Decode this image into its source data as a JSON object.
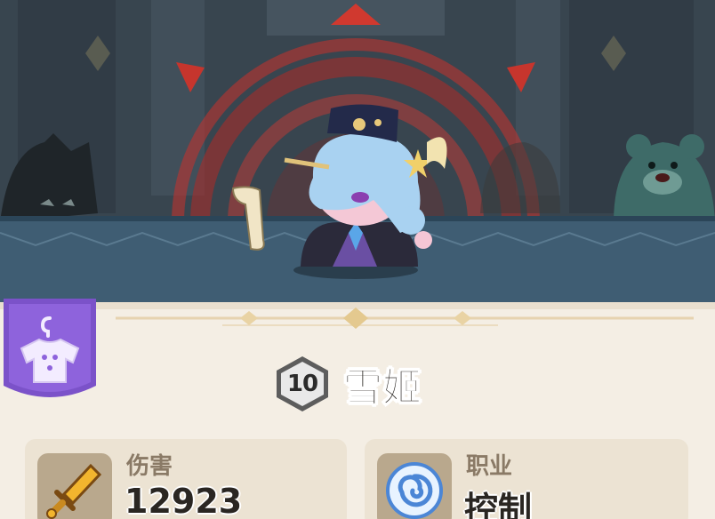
{
  "hero": {
    "level": "10",
    "name": "雪姬"
  },
  "stats": {
    "damage": {
      "label": "伤害",
      "value": "12923",
      "icon": "sword-icon"
    },
    "role": {
      "label": "职业",
      "value": "控制",
      "icon": "swirl-icon"
    }
  },
  "buttons": {
    "wardrobe": {
      "icon": "shirt-hanger-icon"
    }
  },
  "colors": {
    "accent_purple": "#8a62d6",
    "aura_red": "#c8322c",
    "panel_bg": "#f4eee4",
    "icon_box": "#b9a88d"
  }
}
